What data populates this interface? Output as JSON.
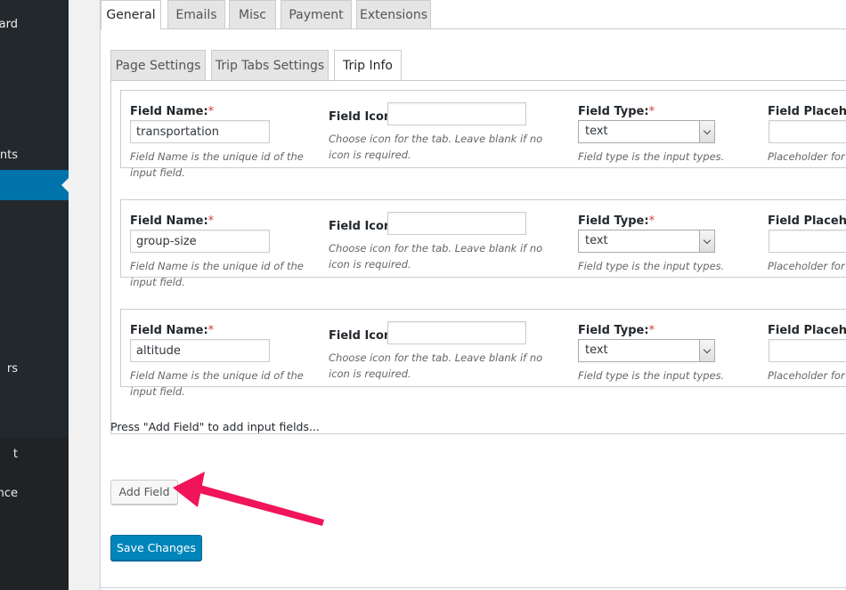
{
  "sidebar": {
    "items": [
      {
        "label": "ard"
      },
      {
        "label": "ents"
      },
      {
        "label": ""
      },
      {
        "label": "rs"
      },
      {
        "label": "t"
      },
      {
        "label": "ance"
      }
    ]
  },
  "tabs": [
    {
      "label": "General"
    },
    {
      "label": "Emails"
    },
    {
      "label": "Misc"
    },
    {
      "label": "Payment"
    },
    {
      "label": "Extensions"
    }
  ],
  "sub_tabs": [
    {
      "label": "Page Settings"
    },
    {
      "label": "Trip Tabs Settings"
    },
    {
      "label": "Trip Info"
    }
  ],
  "labels": {
    "field_name": "Field Name:",
    "field_icon": "Field Icon:",
    "field_type": "Field Type:",
    "field_placeholder": "Field Placehold",
    "required_mark": "*",
    "field_name_desc": "Field Name is the unique id of the input field.",
    "field_icon_desc": "Choose icon for the tab. Leave blank if no icon is required.",
    "field_type_desc": "Field type is the input types.",
    "field_placeholder_desc": "Placeholder for th"
  },
  "fields": [
    {
      "name": "transportation",
      "icon": "",
      "type": "text",
      "placeholder": ""
    },
    {
      "name": "group-size",
      "icon": "",
      "type": "text",
      "placeholder": ""
    },
    {
      "name": "altitude",
      "icon": "",
      "type": "text",
      "placeholder": ""
    }
  ],
  "hint": "Press \"Add Field\" to add input fields...",
  "buttons": {
    "add_field": "Add Field",
    "save_changes": "Save Changes"
  },
  "colors": {
    "accent": "#0073aa",
    "annotation_arrow": "#f0145a"
  }
}
